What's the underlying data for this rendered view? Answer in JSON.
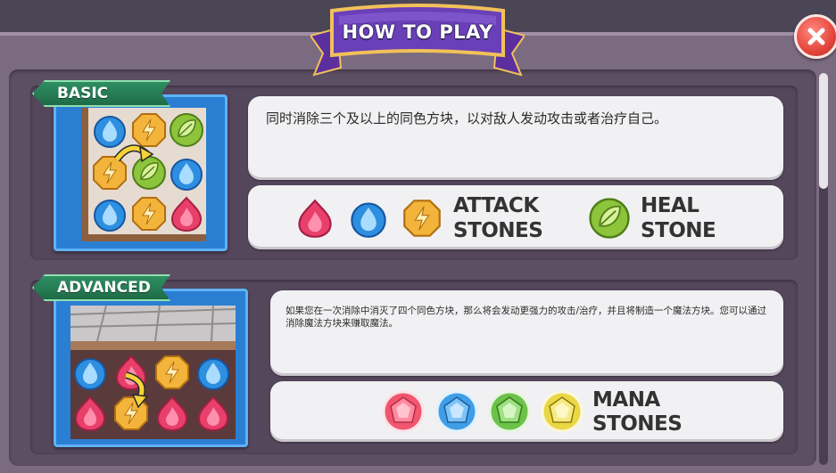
{
  "title": "HOW TO PLAY",
  "sections": {
    "basic": {
      "tag": "BASIC",
      "description": "同时消除三个及以上的同色方块，以对敌人发动攻击或者治疗自己。",
      "attack_line1": "ATTACK",
      "attack_line2": "STONES",
      "heal_line1": "HEAL",
      "heal_line2": "STONE"
    },
    "advanced": {
      "tag": "ADVANCED",
      "description": "如果您在一次消除中消灭了四个同色方块，那么将会发动更强力的攻击/治疗，并且将制造一个魔法方块。您可以通过消除魔法方块来赚取魔法。",
      "mana_line1": "MANA",
      "mana_line2": "STONES"
    }
  },
  "icons": {
    "close": "close-icon",
    "fire": "fire-stone-icon",
    "water": "water-stone-icon",
    "lightning": "lightning-stone-icon",
    "leaf": "leaf-stone-icon",
    "gem_red": "red-mana-gem-icon",
    "gem_blue": "blue-mana-gem-icon",
    "gem_green": "green-mana-gem-icon",
    "gem_yellow": "yellow-mana-gem-icon"
  },
  "colors": {
    "fire": "#e8406a",
    "water": "#2e8fe0",
    "lightning": "#f2b43a",
    "leaf": "#8cc43c",
    "banner": "#6a3fb8",
    "ribbon": "#2e8f63",
    "close": "#e5463c"
  }
}
